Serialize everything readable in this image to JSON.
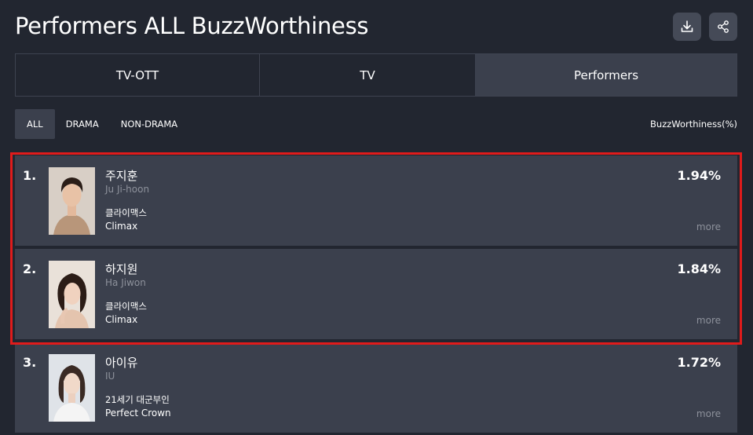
{
  "header": {
    "title": "Performers ALL BuzzWorthiness",
    "download_icon": "download-icon",
    "share_icon": "share-icon"
  },
  "tabs": [
    {
      "label": "TV-OTT",
      "active": false
    },
    {
      "label": "TV",
      "active": false
    },
    {
      "label": "Performers",
      "active": true
    }
  ],
  "filters": [
    {
      "label": "ALL",
      "active": true
    },
    {
      "label": "DRAMA",
      "active": false
    },
    {
      "label": "NON-DRAMA",
      "active": false
    }
  ],
  "metric_label": "BuzzWorthiness(%)",
  "colors": {
    "background": "#222630",
    "card": "#3b404d",
    "highlight": "#e01b1b",
    "muted_text": "#8d919b"
  },
  "rankings": [
    {
      "rank": "1.",
      "name_ko": "주지훈",
      "name_en": "Ju Ji-hoon",
      "show_ko": "클라이맥스",
      "show_en": "Climax",
      "percent": "1.94%",
      "more": "more"
    },
    {
      "rank": "2.",
      "name_ko": "하지원",
      "name_en": "Ha Jiwon",
      "show_ko": "클라이맥스",
      "show_en": "Climax",
      "percent": "1.84%",
      "more": "more"
    },
    {
      "rank": "3.",
      "name_ko": "아이유",
      "name_en": "IU",
      "show_ko": "21세기 대군부인",
      "show_en": "Perfect Crown",
      "percent": "1.72%",
      "more": "more"
    }
  ]
}
